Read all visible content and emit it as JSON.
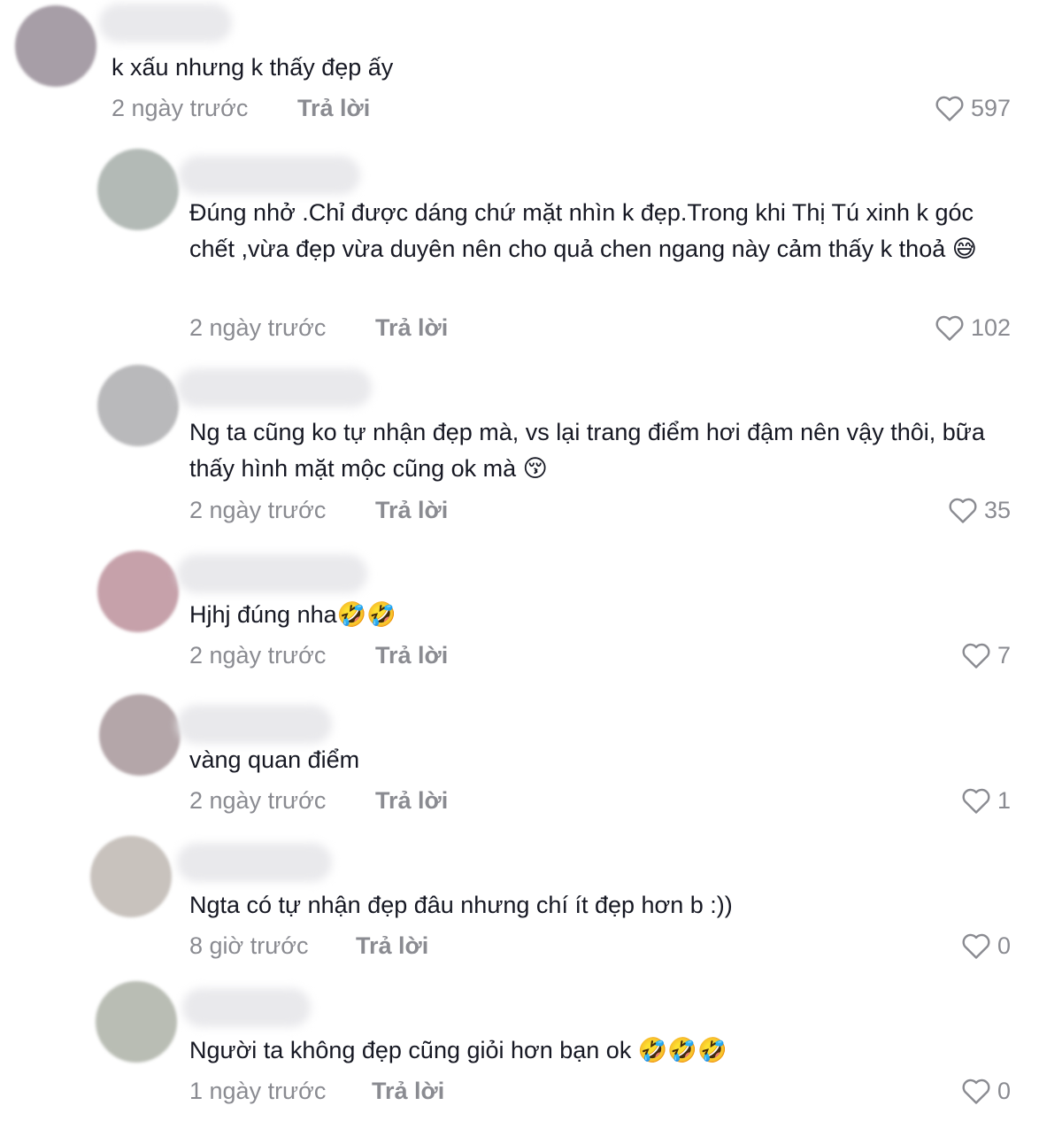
{
  "comments": [
    {
      "text": "k xấu nhưng k thấy đẹp ấy",
      "time": "2 ngày trước",
      "reply": "Trả lời",
      "likes": "597",
      "avatar_color": "#a79ea7"
    },
    {
      "text": "Đúng nhở .Chỉ được dáng chứ mặt nhìn k đẹp.Trong khi Thị Tú xinh k góc chết ,vừa đẹp vừa duyên nên cho quả chen ngang này cảm thấy k thoả 😅",
      "time": "2 ngày trước",
      "reply": "Trả lời",
      "likes": "102",
      "avatar_color": "#b3bab6"
    },
    {
      "text": "Ng ta cũng ko tự nhận đẹp mà, vs lại trang điểm hơi đậm nên vậy thôi, bữa thấy hình mặt mộc cũng ok mà 😚",
      "time": "2 ngày trước",
      "reply": "Trả lời",
      "likes": "35",
      "avatar_color": "#b9b9bb"
    },
    {
      "text": "Hjhj đúng nha🤣🤣",
      "time": "2 ngày trước",
      "reply": "Trả lời",
      "likes": "7",
      "avatar_color": "#c6a1aa"
    },
    {
      "text": "vàng quan điểm",
      "time": "2 ngày trước",
      "reply": "Trả lời",
      "likes": "1",
      "avatar_color": "#b4a6a9"
    },
    {
      "text": "Ngta có tự nhận đẹp đâu nhưng chí ít đẹp hơn b :))",
      "time": "8 giờ trước",
      "reply": "Trả lời",
      "likes": "0",
      "avatar_color": "#c8c2bd"
    },
    {
      "text": "Người ta không đẹp cũng giỏi hơn bạn ok 🤣🤣🤣",
      "time": "1 ngày trước",
      "reply": "Trả lời",
      "likes": "0",
      "avatar_color": "#b9bdb4"
    }
  ]
}
